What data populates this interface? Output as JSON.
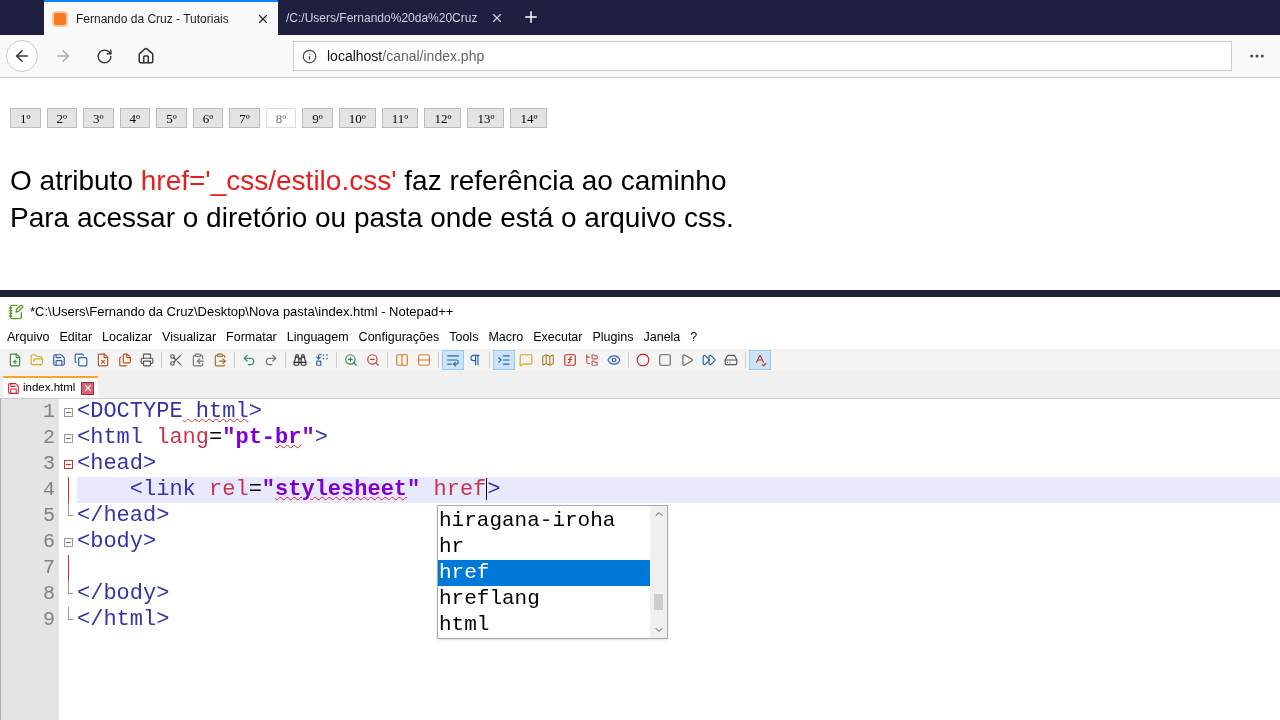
{
  "browser": {
    "tabs": [
      {
        "title": "Fernando da Cruz - Tutoriais",
        "selected": true
      },
      {
        "title": "/C:/Users/Fernando%20da%20Cruz",
        "selected": false
      }
    ],
    "address": {
      "host": "localhost",
      "path": "/canal/index.php"
    }
  },
  "page": {
    "lesson_buttons": [
      {
        "label": "1º",
        "selected": false
      },
      {
        "label": "2º",
        "selected": false
      },
      {
        "label": "3º",
        "selected": false
      },
      {
        "label": "4º",
        "selected": false
      },
      {
        "label": "5º",
        "selected": false
      },
      {
        "label": "6º",
        "selected": false
      },
      {
        "label": "7º",
        "selected": false
      },
      {
        "label": "8º",
        "selected": true
      },
      {
        "label": "9º",
        "selected": false
      },
      {
        "label": "10º",
        "selected": false
      },
      {
        "label": "11º",
        "selected": false
      },
      {
        "label": "12º",
        "selected": false
      },
      {
        "label": "13º",
        "selected": false
      },
      {
        "label": "14º",
        "selected": false
      }
    ],
    "lines": [
      [
        {
          "text": "O atributo ",
          "highlight": false
        },
        {
          "text": "href='_css/estilo.css'",
          "highlight": true
        },
        {
          "text": " faz referência ao caminho",
          "highlight": false
        }
      ],
      [
        {
          "text": "Para acessar o diretório ou pasta onde está o arquivo css.",
          "highlight": false
        }
      ]
    ]
  },
  "editor": {
    "title": "*C:\\Users\\Fernando da Cruz\\Desktop\\Nova pasta\\index.html - Notepad++",
    "menu": [
      "Arquivo",
      "Editar",
      "Localizar",
      "Visualizar",
      "Formatar",
      "Linguagem",
      "Configurações",
      "Tools",
      "Macro",
      "Executar",
      "Plugins",
      "Janela",
      "?"
    ],
    "toolbar": [
      {
        "pressed": false
      },
      {
        "pressed": false
      },
      {
        "pressed": false
      },
      {
        "pressed": false
      },
      {
        "pressed": false
      },
      {
        "pressed": false
      },
      {
        "pressed": false
      },
      {
        "pressed": false
      },
      {
        "pressed": false
      },
      {
        "pressed": false
      },
      {
        "pressed": false
      },
      {
        "pressed": false
      },
      {
        "pressed": false
      },
      {
        "pressed": false
      },
      {
        "pressed": false
      },
      {
        "pressed": false
      },
      {
        "pressed": false
      },
      {
        "pressed": false
      },
      {
        "pressed": true
      },
      {
        "pressed": false
      },
      {
        "pressed": true
      },
      {
        "pressed": false
      },
      {
        "pressed": false
      },
      {
        "pressed": false
      },
      {
        "pressed": false
      },
      {
        "pressed": false
      },
      {
        "pressed": false
      },
      {
        "pressed": false
      },
      {
        "pressed": false
      },
      {
        "pressed": false
      },
      {
        "pressed": false
      },
      {
        "pressed": true
      }
    ],
    "file_tab": {
      "name": "index.html",
      "modified": true
    },
    "lines": [
      {
        "number": "1",
        "kind": "fold_start",
        "current": false,
        "tokens": [
          {
            "text": "<DOCTYPE",
            "kind": "tag",
            "spell_error": false
          },
          {
            "text": " html",
            "kind": "tag",
            "spell_error": true
          },
          {
            "text": ">",
            "kind": "tag",
            "spell_error": false
          }
        ]
      },
      {
        "number": "2",
        "kind": "fold_start",
        "current": false,
        "tokens": [
          {
            "text": "<html",
            "kind": "tag",
            "spell_error": false
          },
          {
            "text": " lang",
            "kind": "attr",
            "spell_error": false
          },
          {
            "text": "=",
            "kind": "plain",
            "spell_error": false
          },
          {
            "text": "\"pt-",
            "kind": "string",
            "spell_error": false
          },
          {
            "text": "br",
            "kind": "string",
            "spell_error": true
          },
          {
            "text": "\"",
            "kind": "string",
            "spell_error": false
          },
          {
            "text": ">",
            "kind": "tag",
            "spell_error": false
          }
        ]
      },
      {
        "number": "3",
        "kind": "fold_start_active",
        "current": false,
        "tokens": [
          {
            "text": "<head>",
            "kind": "tag",
            "spell_error": false
          }
        ]
      },
      {
        "number": "4",
        "kind": "fold_body",
        "current": true,
        "tokens": [
          {
            "text": "    <link",
            "kind": "tag",
            "spell_error": false
          },
          {
            "text": " rel",
            "kind": "attr",
            "spell_error": false
          },
          {
            "text": "=",
            "kind": "plain",
            "spell_error": false
          },
          {
            "text": "\"",
            "kind": "string",
            "spell_error": false
          },
          {
            "text": "stylesheet",
            "kind": "string",
            "spell_error": true
          },
          {
            "text": "\"",
            "kind": "string",
            "spell_error": false
          },
          {
            "text": " href",
            "kind": "attr",
            "spell_error": false,
            "caret": true
          },
          {
            "text": ">",
            "kind": "tag",
            "spell_error": false
          }
        ]
      },
      {
        "number": "5",
        "kind": "fold_end",
        "current": false,
        "tokens": [
          {
            "text": "</head>",
            "kind": "tag",
            "spell_error": false
          }
        ]
      },
      {
        "number": "6",
        "kind": "fold_start",
        "current": false,
        "tokens": [
          {
            "text": "<body>",
            "kind": "tag",
            "spell_error": false
          }
        ]
      },
      {
        "number": "7",
        "kind": "fold_body",
        "current": false
      },
      {
        "number": "8",
        "kind": "fold_end",
        "current": false,
        "tokens": [
          {
            "text": "</body>",
            "kind": "tag",
            "spell_error": false
          }
        ]
      },
      {
        "number": "9",
        "kind": "fold_end",
        "current": false,
        "tokens": [
          {
            "text": "</html>",
            "kind": "tag",
            "spell_error": false
          }
        ]
      }
    ],
    "autocomplete": [
      {
        "text": "hiragana-iroha",
        "selected": false
      },
      {
        "text": "hr",
        "selected": false
      },
      {
        "text": "href",
        "selected": true
      },
      {
        "text": "hreflang",
        "selected": false
      },
      {
        "text": "html",
        "selected": false
      }
    ]
  }
}
